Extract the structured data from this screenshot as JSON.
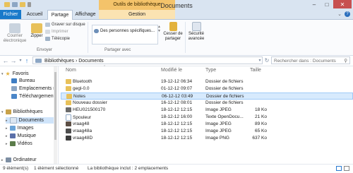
{
  "window": {
    "title": "Documents",
    "context_tab": "Outils de bibliothèque"
  },
  "tabs": [
    "Fichier",
    "Accueil",
    "Partage",
    "Affichage",
    "Gestion"
  ],
  "ribbon": {
    "courrier": "Courrier électronique",
    "zipper": "Zipper",
    "graver": "Graver sur disque",
    "imprimer": "Imprimer",
    "telecopie": "Télécopie",
    "group_send": "Envoyer",
    "share_with": "Des personnes spécifiques...",
    "group_share": "Partager avec",
    "stop_sharing": "Cesser de partager",
    "advanced_security": "Sécurité avancée"
  },
  "navbar": {
    "address": "Bibliothèques › Documents",
    "search_placeholder": "Rechercher dans : Documents"
  },
  "sidebar": {
    "favorites": "Favoris",
    "bureau": "Bureau",
    "emplacements": "Emplacements r",
    "telechargements": "Téléchargement",
    "libraries": "Bibliothèques",
    "documents": "Documents",
    "images": "Images",
    "musique": "Musique",
    "videos": "Vidéos",
    "ordinateur": "Ordinateur"
  },
  "columns": {
    "name": "Nom",
    "modified": "Modifié le",
    "type": "Type",
    "size": "Taille"
  },
  "files": [
    {
      "name": "Bluetooth",
      "modified": "19-12-12 06:34",
      "type": "Dossier de fichiers",
      "size": ""
    },
    {
      "name": "gegl-0.0",
      "modified": "01-12-12 09:07",
      "type": "Dossier de fichiers",
      "size": ""
    },
    {
      "name": "Notes",
      "modified": "06-12-12 03:49",
      "type": "Dossier de fichiers",
      "size": ""
    },
    {
      "name": "Nouveau dossier",
      "modified": "16-12-12 08:01",
      "type": "Dossier de fichiers",
      "size": ""
    },
    {
      "name": "HEU021500170",
      "modified": "18-12-12 12:15",
      "type": "Image JPEG",
      "size": "18 Ko"
    },
    {
      "name": "Spouleur",
      "modified": "18-12-12 16:00",
      "type": "Texte OpenDocu...",
      "size": "21 Ko"
    },
    {
      "name": "vraag48",
      "modified": "18-12-12 12:15",
      "type": "Image JPEG",
      "size": "89 Ko"
    },
    {
      "name": "vraag48a",
      "modified": "18-12-12 12:15",
      "type": "Image JPEG",
      "size": "65 Ko"
    },
    {
      "name": "vraag48D",
      "modified": "18-12-12 12:15",
      "type": "Image PNG",
      "size": "637 Ko"
    }
  ],
  "status": {
    "count": "9 élément(s)",
    "selected": "1 élément sélectionné",
    "library": "La bibliothèque inclut : 2 emplacements"
  },
  "colors": {
    "file_tab": "#1979ca",
    "context_tab": "#f4c36a",
    "selection": "#d7eafd",
    "folder": "#e8c15a"
  }
}
